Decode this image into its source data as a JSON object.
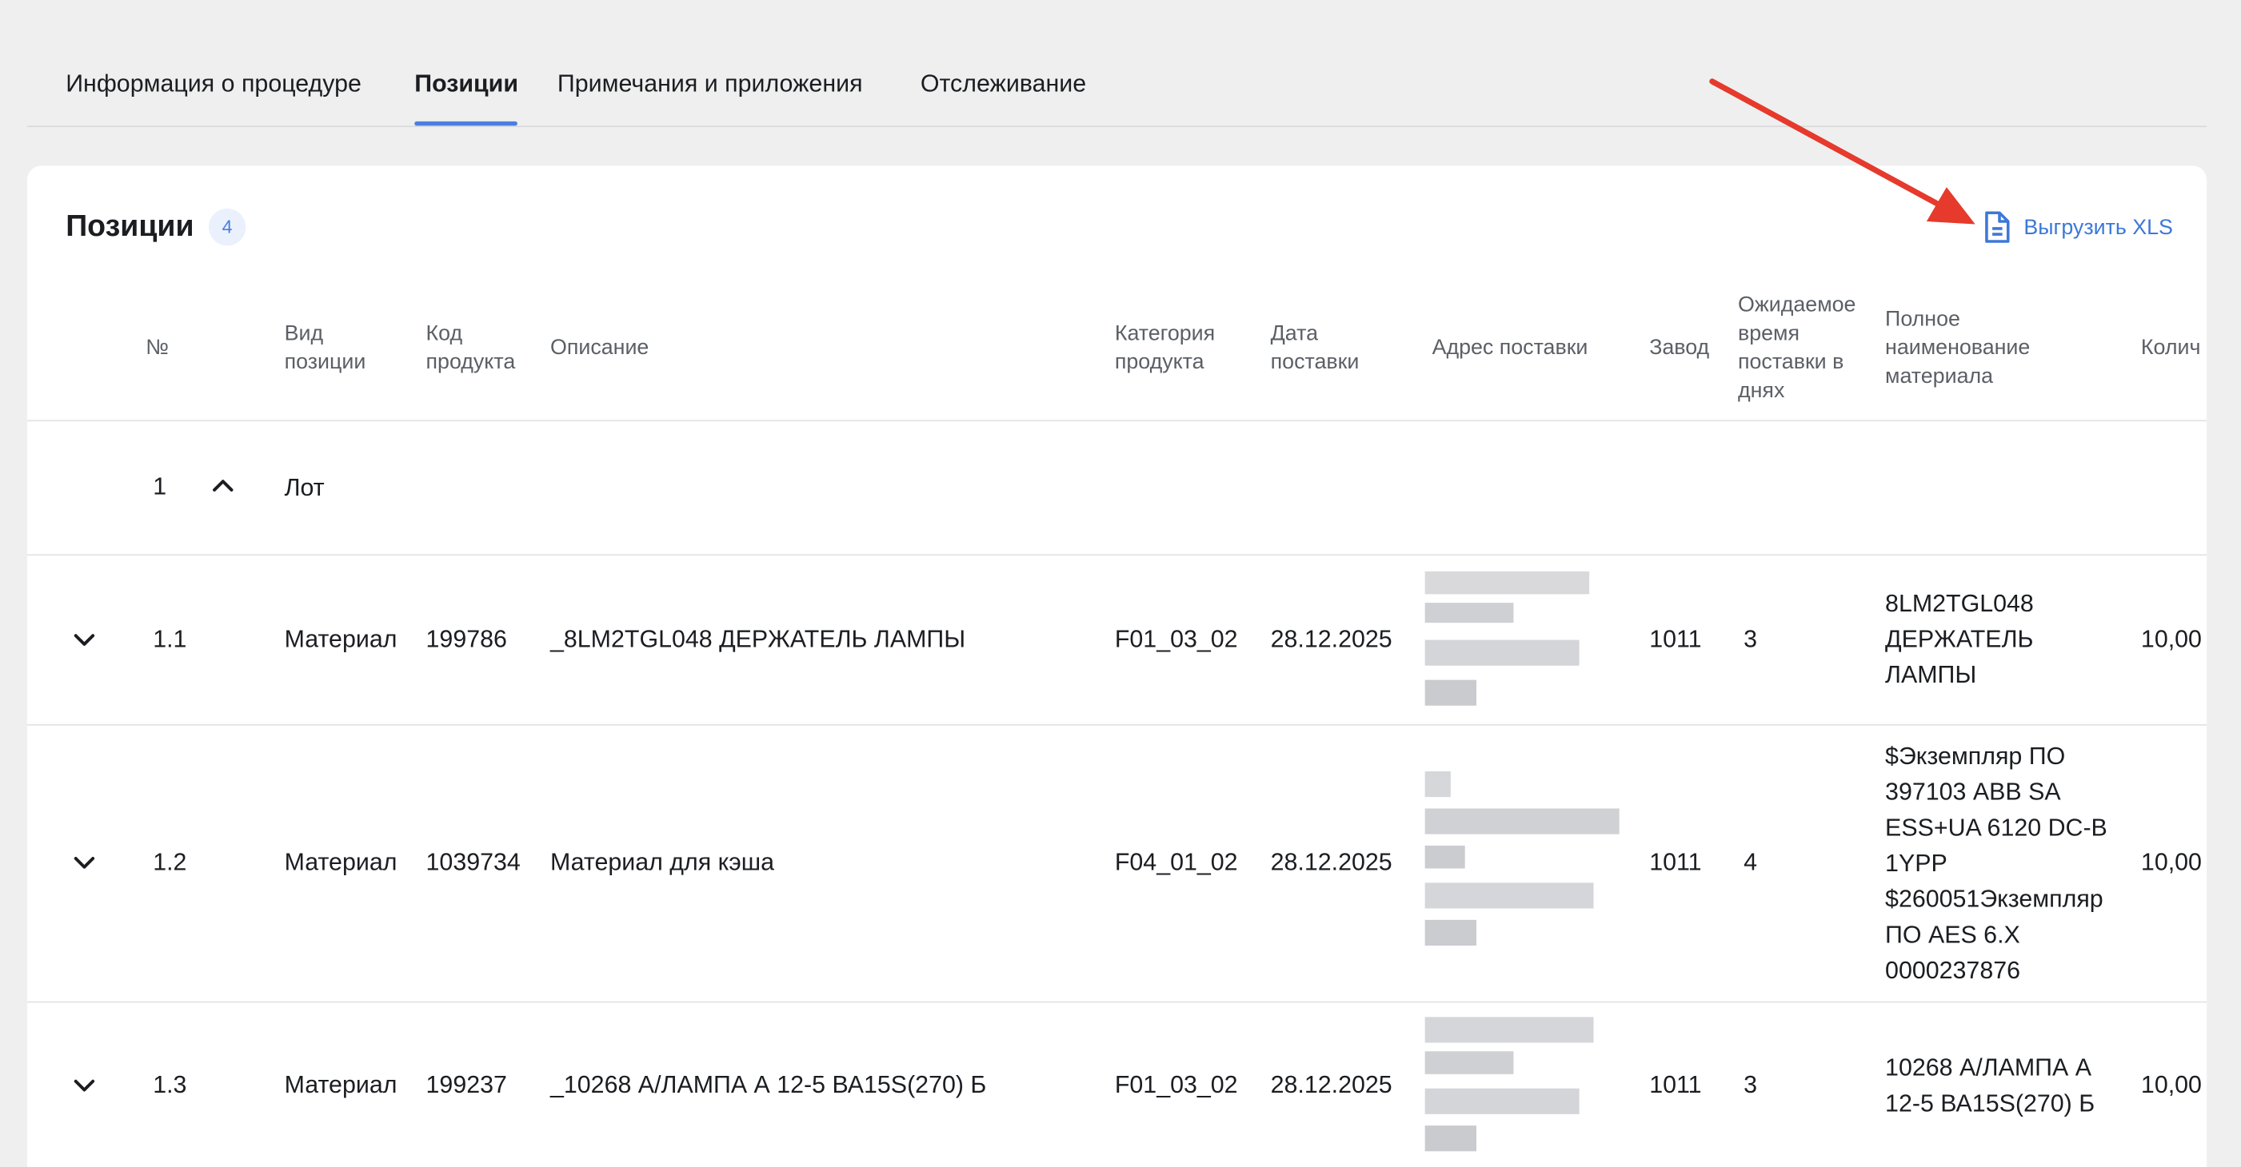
{
  "tabs": [
    {
      "label": "Информация о процедуре",
      "active": false
    },
    {
      "label": "Позиции",
      "active": true
    },
    {
      "label": "Примечания и приложения",
      "active": false
    },
    {
      "label": "Отслеживание",
      "active": false
    }
  ],
  "section": {
    "title": "Позиции",
    "count": "4",
    "export_label": "Выгрузить XLS"
  },
  "columns": {
    "num": "№",
    "type": "Вид позиции",
    "code": "Код продукта",
    "description": "Описание",
    "category": "Категория продукта",
    "date": "Дата поставки",
    "address": "Адрес поставки",
    "plant": "Завод",
    "lead_time": "Ожидаемое время поставки в днях",
    "full_name": "Полное наименование материала",
    "quantity": "Колич"
  },
  "lot": {
    "num": "1",
    "label": "Лот"
  },
  "rows": [
    {
      "num": "1.1",
      "type": "Материал",
      "code": "199786",
      "description": "_8LM2TGL048 ДЕРЖАТЕЛЬ ЛАМПЫ",
      "category": "F01_03_02",
      "date": "28.12.2025",
      "plant": "1011",
      "lead_time": "3",
      "full_name": "8LM2TGL048 ДЕРЖАТЕЛЬ ЛАМПЫ",
      "quantity": "10,00"
    },
    {
      "num": "1.2",
      "type": "Материал",
      "code": "1039734",
      "description": "Материал для кэша",
      "category": "F04_01_02",
      "date": "28.12.2025",
      "plant": "1011",
      "lead_time": "4",
      "full_name": "$Экземпляр ПО 397103 ABB SA ESS+UA 6120 DC-B 1YPP $260051Экземпляр ПО AES 6.X 0000237876",
      "quantity": "10,00"
    },
    {
      "num": "1.3",
      "type": "Материал",
      "code": "199237",
      "description": "_10268 А/ЛАМПА А 12-5 ВА15S(270) Б",
      "category": "F01_03_02",
      "date": "28.12.2025",
      "plant": "1011",
      "lead_time": "3",
      "full_name": "10268 А/ЛАМПА А 12-5 ВА15S(270) Б",
      "quantity": "10,00"
    }
  ],
  "icons": {
    "export": "document-icon",
    "lot_toggle": "chevron-up-icon",
    "row_toggle": "chevron-down-icon"
  },
  "colors": {
    "accent": "#4a7fe0",
    "annotation_arrow": "#e53a2c"
  }
}
